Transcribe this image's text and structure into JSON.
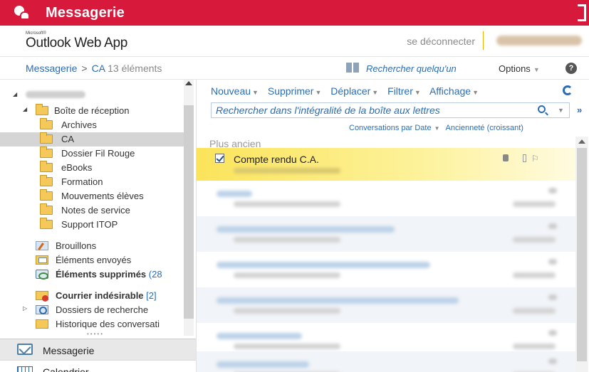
{
  "app": {
    "title": "Messagerie"
  },
  "header": {
    "brand_ms": "Microsoft®",
    "brand": "Outlook Web App",
    "signout": "se déconnecter",
    "username_hidden": true
  },
  "crumbs": {
    "root": "Messagerie",
    "sep": ">",
    "folder": "CA",
    "count": "13 éléments"
  },
  "find_people": "Rechercher quelqu'un",
  "options": "Options",
  "help": "?",
  "folders": [
    {
      "label": "Boîte de réception",
      "icon": "folder-icon"
    },
    {
      "label": "Archives",
      "icon": "folder-icon"
    },
    {
      "label": "CA",
      "icon": "folder-icon",
      "selected": true
    },
    {
      "label": "Dossier Fil Rouge",
      "icon": "folder-icon"
    },
    {
      "label": "eBooks",
      "icon": "folder-icon"
    },
    {
      "label": "Formation",
      "icon": "folder-icon"
    },
    {
      "label": "Mouvements élèves",
      "icon": "folder-icon"
    },
    {
      "label": "Notes de service",
      "icon": "folder-icon"
    },
    {
      "label": "Support ITOP",
      "icon": "folder-icon"
    },
    {
      "label": "Brouillons",
      "icon": "drafts-icon"
    },
    {
      "label": "Éléments envoyés",
      "icon": "sent-icon"
    },
    {
      "label": "Éléments supprimés",
      "count": "(28",
      "icon": "trash-icon"
    },
    {
      "label": "Courrier indésirable",
      "count": "[2]",
      "icon": "junk-icon"
    },
    {
      "label": "Dossiers de recherche",
      "icon": "search-folder-icon"
    },
    {
      "label": "Historique des conversati",
      "icon": "folder-icon"
    }
  ],
  "nav": {
    "mail": "Messagerie",
    "calendar": "Calendrier"
  },
  "toolbar": {
    "new": "Nouveau",
    "delete": "Supprimer",
    "move": "Déplacer",
    "filter": "Filtrer",
    "view": "Affichage"
  },
  "search": {
    "placeholder": "Rechercher dans l'intégralité de la boîte aux lettres"
  },
  "sort": {
    "by": "Conversations par Date",
    "order": "Ancienneté (croissant)"
  },
  "list_header": "Plus ancien",
  "messages": [
    {
      "subject": "Compte rendu C.A.",
      "selected": true,
      "checked": true
    }
  ],
  "colors": {
    "accent_red": "#d71a3b",
    "link_blue": "#2b6db5",
    "selection_yellow": "#fbe45a"
  }
}
